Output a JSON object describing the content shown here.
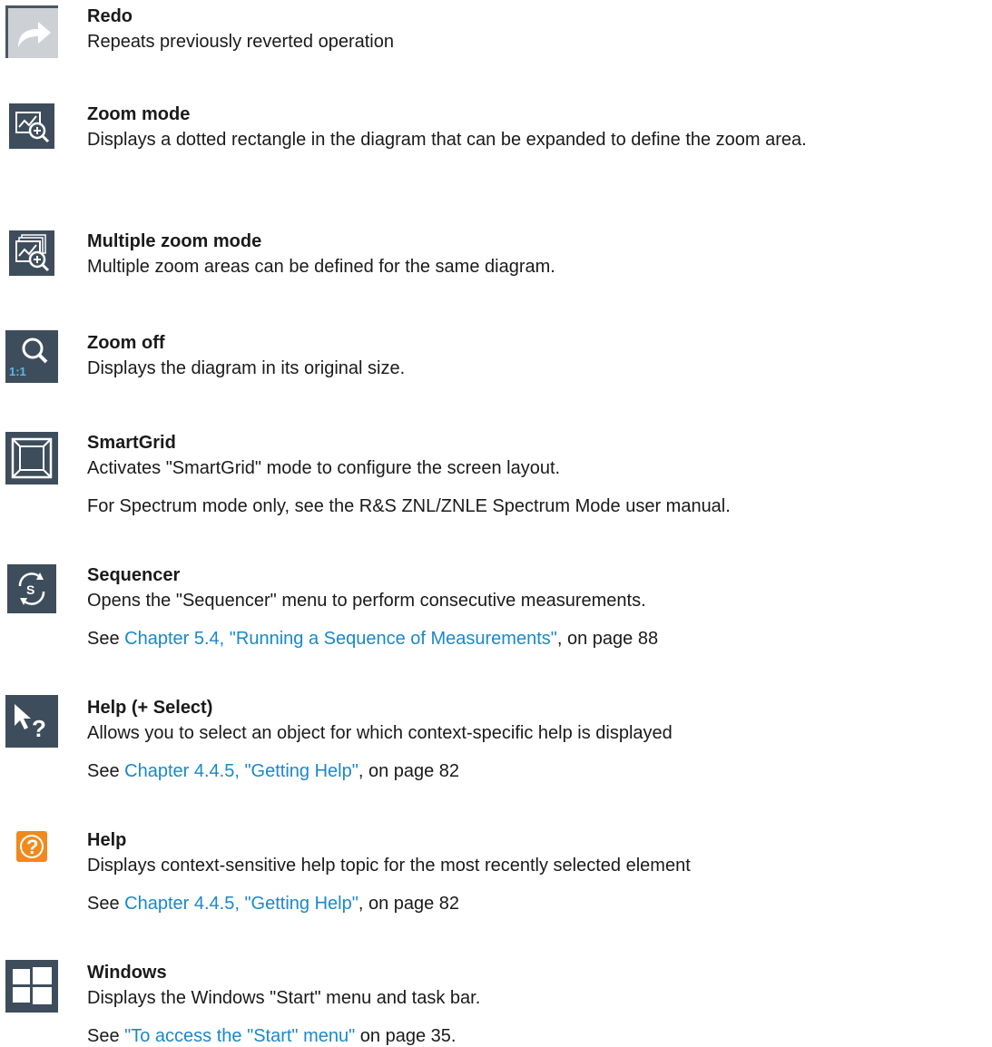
{
  "items": [
    {
      "icon": "redo-icon",
      "title": "Redo",
      "description": "Repeats previously reverted operation"
    },
    {
      "icon": "zoom-mode-icon",
      "title": "Zoom mode",
      "description": "Displays a dotted rectangle in the diagram that can be expanded to define the zoom area."
    },
    {
      "icon": "multiple-zoom-mode-icon",
      "title": "Multiple zoom mode",
      "description": "Multiple zoom areas can be defined for the same diagram."
    },
    {
      "icon": "zoom-off-icon",
      "icon_text": "1:1",
      "title": "Zoom off",
      "description": "Displays the diagram in its original size."
    },
    {
      "icon": "smartgrid-icon",
      "title": "SmartGrid",
      "description": "Activates \"SmartGrid\" mode to configure the screen layout.",
      "note": "For Spectrum mode only, see the R&S ZNL/ZNLE Spectrum Mode user manual."
    },
    {
      "icon": "sequencer-icon",
      "icon_text": "S",
      "title": "Sequencer",
      "description": "Opens the \"Sequencer\" menu to perform consecutive measurements.",
      "see_prefix": "See ",
      "see_link": "Chapter 5.4, \"Running a Sequence of Measurements\"",
      "see_suffix": ", on page 88"
    },
    {
      "icon": "help-select-icon",
      "icon_text": "?",
      "title": "Help (+ Select)",
      "description": "Allows you to select an object for which context-specific help is displayed",
      "see_prefix": "See ",
      "see_link": "Chapter 4.4.5, \"Getting Help\"",
      "see_suffix": ", on page 82"
    },
    {
      "icon": "help-icon",
      "icon_text": "?",
      "title": "Help",
      "description": "Displays context-sensitive help topic for the most recently selected element",
      "see_prefix": "See ",
      "see_link": "Chapter 4.4.5, \"Getting Help\"",
      "see_suffix": ", on page 82"
    },
    {
      "icon": "windows-icon",
      "title": "Windows",
      "description": "Displays the Windows \"Start\" menu and task bar.",
      "see_prefix": "See ",
      "see_link": "\"To access the \"Start\" menu\"",
      "see_suffix": " on page 35."
    }
  ],
  "colors": {
    "link": "#1a88c9",
    "icon_dark": "#3e4d5c",
    "icon_light": "#c9cdd1",
    "help_orange": "#f08a1c"
  }
}
